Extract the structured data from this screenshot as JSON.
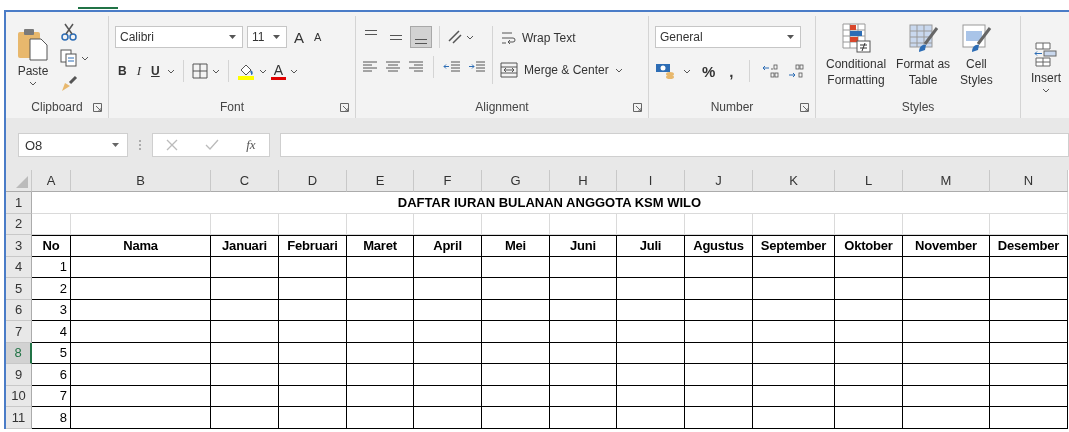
{
  "ribbon": {
    "clipboard": {
      "paste": "Paste",
      "label": "Clipboard"
    },
    "font": {
      "font_name": "Calibri",
      "font_size": "11",
      "grow_font": "A",
      "shrink_font": "A",
      "bold": "B",
      "italic": "I",
      "underline": "U",
      "font_color": "A",
      "label": "Font"
    },
    "alignment": {
      "vertical_align": [
        {
          "selected": false
        },
        {
          "selected": false
        },
        {
          "selected": true
        }
      ],
      "wrap_text": "Wrap Text",
      "merge_center": "Merge & Center",
      "label": "Alignment"
    },
    "number": {
      "format": "General",
      "percent": "%",
      "comma": ",",
      "label": "Number"
    },
    "styles": {
      "buttons": [
        {
          "kind": "conditional",
          "lines": [
            "Conditional",
            "Formatting"
          ]
        },
        {
          "kind": "table",
          "lines": [
            "Format as",
            "Table"
          ]
        },
        {
          "kind": "cell",
          "lines": [
            "Cell",
            "Styles"
          ]
        }
      ],
      "label": "Styles"
    },
    "cells": {
      "insert": "Insert"
    }
  },
  "formula_bar": {
    "name_box": "O8",
    "function_label": "fx"
  },
  "sheet": {
    "columns": [
      "A",
      "B",
      "C",
      "D",
      "E",
      "F",
      "G",
      "H",
      "I",
      "J",
      "K",
      "L",
      "M",
      "N"
    ],
    "rows": [
      {
        "number": "1",
        "selected": false,
        "kind": "title",
        "text": "DAFTAR IURAN BULANAN ANGGOTA KSM WILO"
      },
      {
        "number": "2",
        "selected": false,
        "kind": "empty"
      },
      {
        "number": "3",
        "selected": false,
        "kind": "header",
        "cells": [
          "No",
          "Nama",
          "Januari",
          "Februari",
          "Maret",
          "April",
          "Mei",
          "Juni",
          "Juli",
          "Agustus",
          "September",
          "Oktober",
          "November",
          "Desember"
        ]
      },
      {
        "number": "4",
        "selected": false,
        "kind": "entry",
        "no": "1"
      },
      {
        "number": "5",
        "selected": false,
        "kind": "entry",
        "no": "2"
      },
      {
        "number": "6",
        "selected": false,
        "kind": "entry",
        "no": "3"
      },
      {
        "number": "7",
        "selected": false,
        "kind": "entry",
        "no": "4"
      },
      {
        "number": "8",
        "selected": true,
        "kind": "entry",
        "no": "5"
      },
      {
        "number": "9",
        "selected": false,
        "kind": "entry",
        "no": "6"
      },
      {
        "number": "10",
        "selected": false,
        "kind": "entry",
        "no": "7"
      },
      {
        "number": "11",
        "selected": false,
        "kind": "entry",
        "no": "8"
      }
    ]
  }
}
